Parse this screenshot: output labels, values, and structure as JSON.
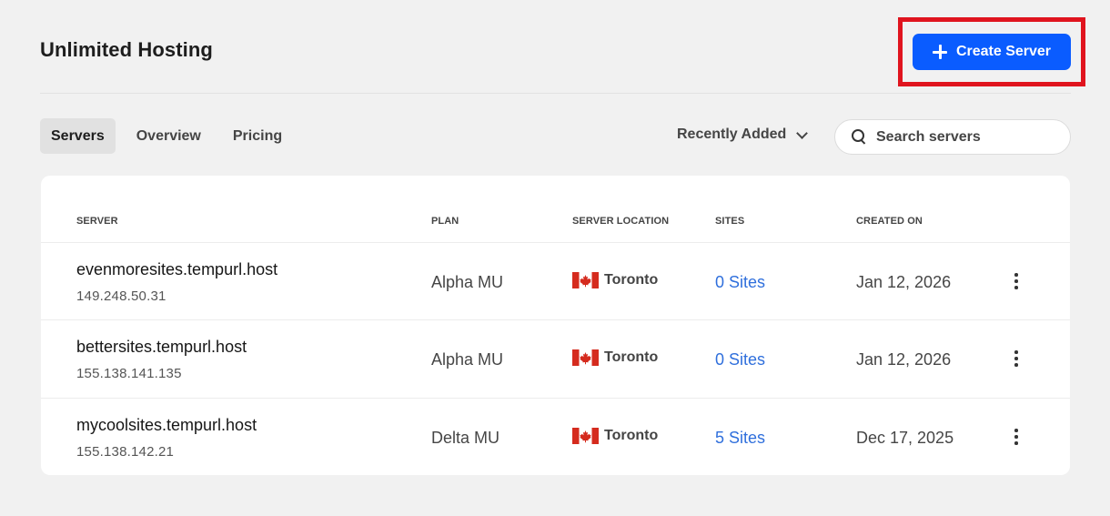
{
  "header": {
    "title": "Unlimited Hosting",
    "create_button_label": "Create Server",
    "highlight_color": "#e0141e",
    "accent_color": "#0a5cff"
  },
  "tabs": [
    {
      "label": "Servers",
      "active": true
    },
    {
      "label": "Overview",
      "active": false
    },
    {
      "label": "Pricing",
      "active": false
    }
  ],
  "sort": {
    "selected": "Recently Added"
  },
  "search": {
    "placeholder": "Search servers",
    "value": ""
  },
  "table": {
    "columns": [
      "SERVER",
      "PLAN",
      "SERVER LOCATION",
      "SITES",
      "CREATED ON"
    ],
    "rows": [
      {
        "name": "evenmoresites.tempurl.host",
        "ip": "149.248.50.31",
        "plan": "Alpha MU",
        "location": "Toronto",
        "flag_icon": "flag-canada-icon",
        "sites": "0 Sites",
        "created": "Jan 12, 2026"
      },
      {
        "name": "bettersites.tempurl.host",
        "ip": "155.138.141.135",
        "plan": "Alpha MU",
        "location": "Toronto",
        "flag_icon": "flag-canada-icon",
        "sites": "0 Sites",
        "created": "Jan 12, 2026"
      },
      {
        "name": "mycoolsites.tempurl.host",
        "ip": "155.138.142.21",
        "plan": "Delta MU",
        "location": "Toronto",
        "flag_icon": "flag-canada-icon",
        "sites": "5 Sites",
        "created": "Dec 17, 2025"
      }
    ]
  }
}
